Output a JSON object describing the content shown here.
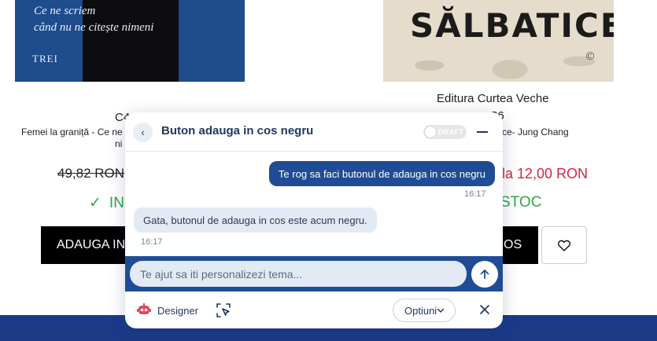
{
  "products": {
    "left": {
      "cover_line1": "Ce ne scriem",
      "cover_line2": "când nu ne citește nimeni",
      "cover_brand": "TREI",
      "code": "C4",
      "name": "Femei la graniță - Ce ne",
      "name_line2": "ni",
      "old_price": "49,82 RON",
      "stock": "IN",
      "add_button": "ADAUGA IN"
    },
    "right": {
      "cover_title": "SĂLBATICE",
      "publisher": "Editura Curtea Veche",
      "code": "36",
      "name": "ce- Jung Chang",
      "new_price": "la 12,00 RON",
      "stock": "STOC",
      "add_button": "OS"
    }
  },
  "chat": {
    "title": "Buton adauga in cos negru",
    "draft_label": "DRAFT",
    "messages": [
      {
        "role": "user",
        "text": "Te rog sa faci butonul de adauga in cos negru",
        "time": "16:17"
      },
      {
        "role": "bot",
        "text": "Gata, butonul de adauga in cos este acum negru.",
        "time": "16:17"
      }
    ],
    "input_placeholder": "Te ajut sa iti personalizezi tema...",
    "designer_label": "Designer",
    "options_label": "Optiuni"
  },
  "colors": {
    "chat_primary": "#1f4c94",
    "price_red": "#d7263d",
    "stock_green": "#2ea64a",
    "footer_band": "#1c3a88"
  },
  "icons": [
    "back-icon",
    "minimize-icon",
    "send-icon",
    "designer-robot-icon",
    "element-picker-icon",
    "chevron-down-icon",
    "close-icon",
    "heart-icon",
    "check-icon"
  ]
}
